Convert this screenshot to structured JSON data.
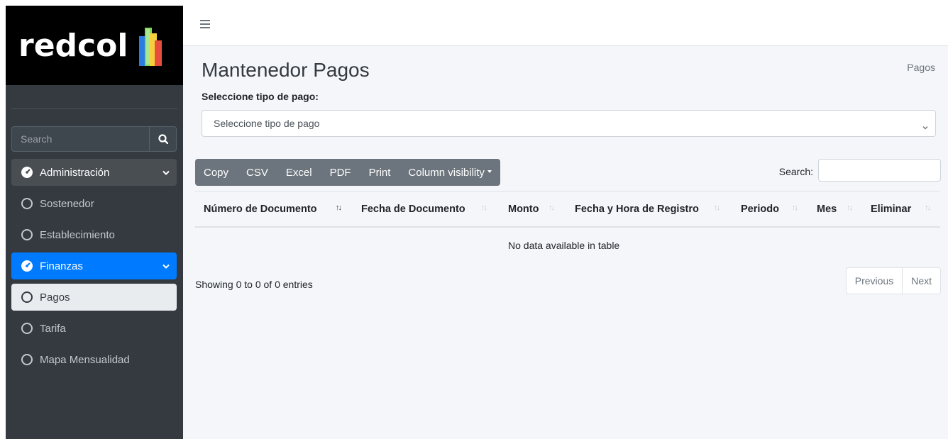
{
  "brand": {
    "name": "redcol"
  },
  "sidebar": {
    "search_placeholder": "Search",
    "items": [
      {
        "label": "Administración",
        "icon": "tachometer-icon"
      },
      {
        "label": "Sostenedor",
        "icon": "circle-icon"
      },
      {
        "label": "Establecimiento",
        "icon": "circle-icon"
      },
      {
        "label": "Finanzas",
        "icon": "tachometer-icon"
      },
      {
        "label": "Pagos",
        "icon": "circle-icon"
      },
      {
        "label": "Tarifa",
        "icon": "circle-icon"
      },
      {
        "label": "Mapa Mensualidad",
        "icon": "circle-icon"
      }
    ]
  },
  "page": {
    "title": "Mantenedor Pagos",
    "breadcrumb": "Pagos",
    "select_label": "Seleccione tipo de pago:",
    "select_value": "Seleccione tipo de pago"
  },
  "table": {
    "buttons": [
      "Copy",
      "CSV",
      "Excel",
      "PDF",
      "Print",
      "Column visibility"
    ],
    "search_label": "Search:",
    "columns": [
      "Número de Documento",
      "Fecha de Documento",
      "Monto",
      "Fecha y Hora de Registro",
      "Periodo",
      "Mes",
      "Eliminar"
    ],
    "empty_message": "No data available in table",
    "info": "Showing 0 to 0 of 0 entries",
    "pagination": {
      "previous": "Previous",
      "next": "Next"
    }
  },
  "colors": {
    "sidebar_bg": "#343a40",
    "active_blue": "#007bff",
    "button_gray": "#6c757d"
  }
}
